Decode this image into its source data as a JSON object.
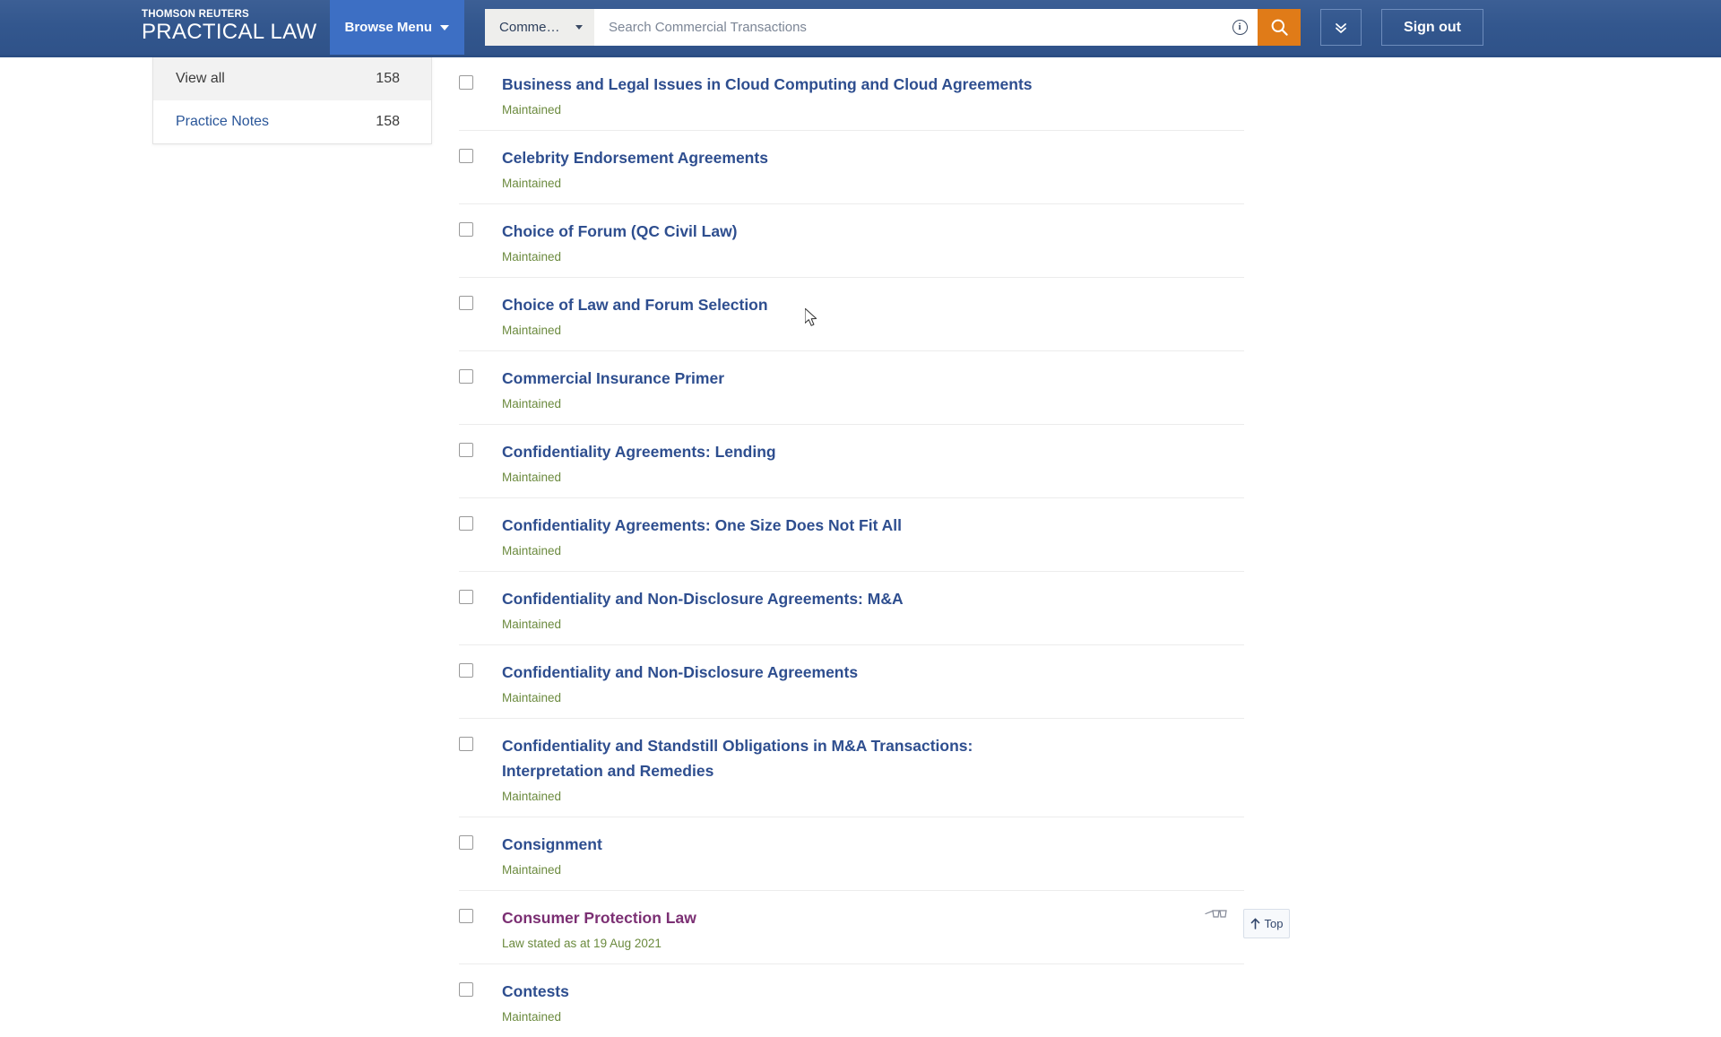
{
  "header": {
    "logo_top": "THOMSON REUTERS",
    "logo_bottom": "PRACTICAL LAW",
    "browse_menu_label": "Browse Menu",
    "scope_label": "Commercial Transact…",
    "search_placeholder": "Search Commercial Transactions",
    "search_value": "",
    "info_glyph": "i",
    "signout_label": "Sign out",
    "icons": {
      "search": "search-icon",
      "info": "info-icon",
      "chevrons": "double-chevron-down-icon",
      "caret": "chevron-down-icon"
    },
    "colors": {
      "header_blue": "#33578e",
      "browse_blue": "#3d6fc4",
      "search_orange": "#e07b18"
    }
  },
  "facets": {
    "items": [
      {
        "label": "View all",
        "count": "158",
        "active": true
      },
      {
        "label": "Practice Notes",
        "count": "158",
        "active": false
      }
    ]
  },
  "results": {
    "items": [
      {
        "title": "Business and Legal Issues in Cloud Computing and Cloud Agreements",
        "status": "Maintained",
        "visited": false,
        "viewed_icon": false
      },
      {
        "title": "Celebrity Endorsement Agreements",
        "status": "Maintained",
        "visited": false,
        "viewed_icon": false
      },
      {
        "title": "Choice of Forum (QC Civil Law)",
        "status": "Maintained",
        "visited": false,
        "viewed_icon": false
      },
      {
        "title": "Choice of Law and Forum Selection",
        "status": "Maintained",
        "visited": false,
        "viewed_icon": false
      },
      {
        "title": "Commercial Insurance Primer",
        "status": "Maintained",
        "visited": false,
        "viewed_icon": false
      },
      {
        "title": "Confidentiality Agreements: Lending",
        "status": "Maintained",
        "visited": false,
        "viewed_icon": false
      },
      {
        "title": "Confidentiality Agreements: One Size Does Not Fit All",
        "status": "Maintained",
        "visited": false,
        "viewed_icon": false
      },
      {
        "title": "Confidentiality and Non-Disclosure Agreements: M&A",
        "status": "Maintained",
        "visited": false,
        "viewed_icon": false
      },
      {
        "title": "Confidentiality and Non-Disclosure Agreements",
        "status": "Maintained",
        "visited": false,
        "viewed_icon": false
      },
      {
        "title": "Confidentiality and Standstill Obligations in M&A Transactions: Interpretation and Remedies",
        "status": "Maintained",
        "visited": false,
        "viewed_icon": false
      },
      {
        "title": "Consignment",
        "status": "Maintained",
        "visited": false,
        "viewed_icon": false
      },
      {
        "title": "Consumer Protection Law",
        "status": "Law stated as at 19 Aug 2021",
        "visited": true,
        "viewed_icon": true
      },
      {
        "title": "Contests",
        "status": "Maintained",
        "visited": false,
        "viewed_icon": false
      }
    ],
    "colors": {
      "title": "#2e4e8f",
      "title_visited": "#7b2f73",
      "status": "#6b8a3e"
    }
  },
  "top_button": {
    "label": "Top",
    "icon": "arrow-up-icon"
  }
}
